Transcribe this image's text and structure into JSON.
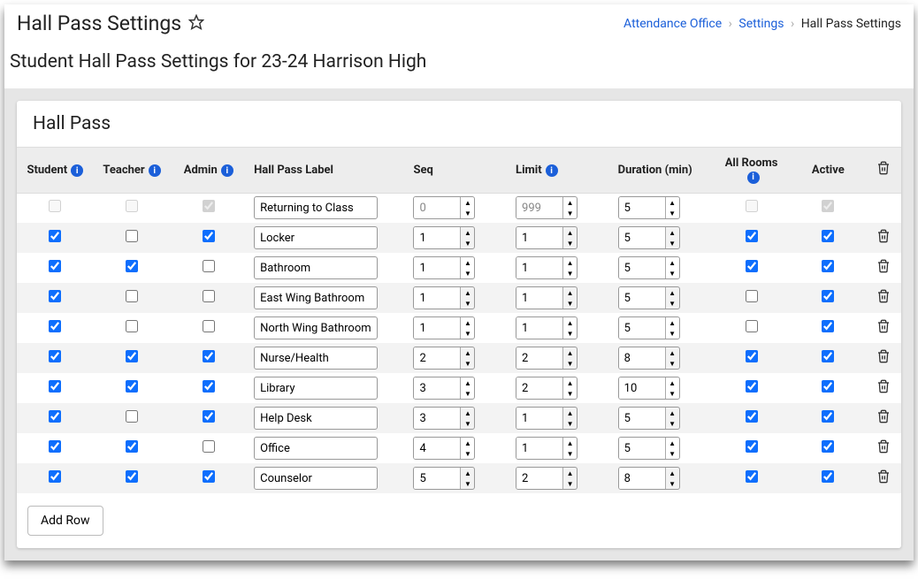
{
  "page_title": "Hall Pass Settings",
  "breadcrumb": {
    "a": "Attendance Office",
    "b": "Settings",
    "c": "Hall Pass Settings"
  },
  "subtitle": "Student Hall Pass Settings for 23-24 Harrison High",
  "panel_title": "Hall Pass",
  "headers": {
    "student": "Student",
    "teacher": "Teacher",
    "admin": "Admin",
    "label": "Hall Pass Label",
    "seq": "Seq",
    "limit": "Limit",
    "duration": "Duration (min)",
    "allrooms": "All Rooms",
    "active": "Active"
  },
  "add_row": "Add Row",
  "rows": [
    {
      "student": false,
      "teacher": false,
      "admin": true,
      "label": "Returning to Class",
      "seq": "0",
      "limit": "999",
      "duration": "5",
      "allrooms": false,
      "active": true,
      "locked": true,
      "deletable": false
    },
    {
      "student": true,
      "teacher": false,
      "admin": true,
      "label": "Locker",
      "seq": "1",
      "limit": "1",
      "duration": "5",
      "allrooms": true,
      "active": true,
      "locked": false,
      "deletable": true
    },
    {
      "student": true,
      "teacher": true,
      "admin": false,
      "label": "Bathroom",
      "seq": "1",
      "limit": "1",
      "duration": "5",
      "allrooms": true,
      "active": true,
      "locked": false,
      "deletable": true
    },
    {
      "student": true,
      "teacher": false,
      "admin": false,
      "label": "East Wing Bathroom",
      "seq": "1",
      "limit": "1",
      "duration": "5",
      "allrooms": false,
      "active": true,
      "locked": false,
      "deletable": true
    },
    {
      "student": true,
      "teacher": false,
      "admin": false,
      "label": "North Wing Bathroom",
      "seq": "1",
      "limit": "1",
      "duration": "5",
      "allrooms": false,
      "active": true,
      "locked": false,
      "deletable": true
    },
    {
      "student": true,
      "teacher": true,
      "admin": true,
      "label": "Nurse/Health",
      "seq": "2",
      "limit": "2",
      "duration": "8",
      "allrooms": true,
      "active": true,
      "locked": false,
      "deletable": true
    },
    {
      "student": true,
      "teacher": true,
      "admin": true,
      "label": "Library",
      "seq": "3",
      "limit": "2",
      "duration": "10",
      "allrooms": true,
      "active": true,
      "locked": false,
      "deletable": true
    },
    {
      "student": true,
      "teacher": false,
      "admin": true,
      "label": "Help Desk",
      "seq": "3",
      "limit": "1",
      "duration": "5",
      "allrooms": true,
      "active": true,
      "locked": false,
      "deletable": true
    },
    {
      "student": true,
      "teacher": true,
      "admin": false,
      "label": "Office",
      "seq": "4",
      "limit": "1",
      "duration": "5",
      "allrooms": true,
      "active": true,
      "locked": false,
      "deletable": true
    },
    {
      "student": true,
      "teacher": true,
      "admin": true,
      "label": "Counselor",
      "seq": "5",
      "limit": "2",
      "duration": "8",
      "allrooms": true,
      "active": true,
      "locked": false,
      "deletable": true
    }
  ]
}
